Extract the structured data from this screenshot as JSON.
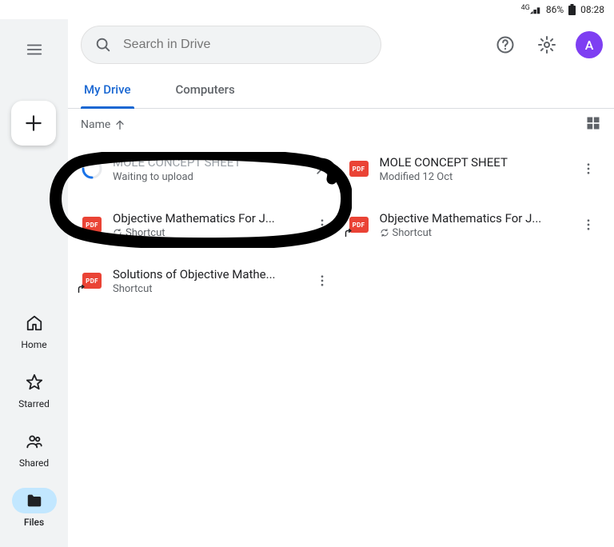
{
  "status_bar": {
    "net": "4G",
    "battery_pct": "86%",
    "time": "08:28"
  },
  "search": {
    "placeholder": "Search in Drive"
  },
  "avatar_initial": "A",
  "tabs": [
    {
      "label": "My Drive",
      "active": true
    },
    {
      "label": "Computers",
      "active": false
    }
  ],
  "list_header": {
    "sort_label": "Name"
  },
  "sidebar_nav": {
    "home": "Home",
    "starred": "Starred",
    "shared": "Shared",
    "files": "Files"
  },
  "files": {
    "uploading": {
      "title": "MOLE CONCEPT SHEET",
      "status": "Waiting to upload"
    },
    "f1": {
      "title": "MOLE CONCEPT SHEET",
      "sub": "Modified 12 Oct"
    },
    "f2": {
      "title": "Objective Mathematics For J...",
      "sub": "Shortcut"
    },
    "f3": {
      "title": "Objective Mathematics For J...",
      "sub": "Shortcut"
    },
    "f4": {
      "title": "Solutions of Objective Mathe...",
      "sub": "Shortcut"
    }
  },
  "pdf_label": "PDF"
}
